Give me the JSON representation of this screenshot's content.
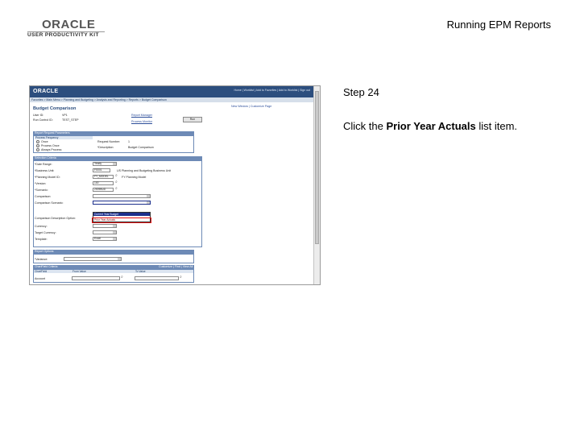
{
  "branding": {
    "logo_text": "ORACLE",
    "product_text": "USER PRODUCTIVITY KIT"
  },
  "document": {
    "title": "Running EPM Reports"
  },
  "step": {
    "title": "Step 24",
    "instruction_prefix": "Click the ",
    "instruction_target": "Prior Year Actuals",
    "instruction_suffix": " list item."
  },
  "screenshot": {
    "header": {
      "logo": "ORACLE",
      "links": "Home | Worklist | Add to Favorites | Add to Worklist | Sign out"
    },
    "nav": "Favorites > Main Menu > Planning and Budgeting > Analysis and Reporting > Reports > Budget Comparison",
    "page_title": "Budget Comparison",
    "run_control_label": "User ID:",
    "run_control_value": "VP1",
    "run_control_id_label": "Run Control ID:",
    "run_control_id_value": "TEST_STEP",
    "report_manager_link": "Report Manager",
    "process_monitor_link": "Process Monitor",
    "run_button": "Run",
    "toolbar_links": "New Window | Customize Page",
    "sections": {
      "report_request": "Report Request Parameters",
      "process_frequency": "Process Frequency",
      "selection_criteria": "Selection Criteria",
      "report_option": "Report Options",
      "chartfield_criteria": "ChartField Criteria"
    },
    "frequency_options": [
      "Once",
      "Process Once",
      "Always Process"
    ],
    "request_number_label": "Request Number:",
    "request_number_value": "1",
    "description_label": "*Description:",
    "description_value": "Budget Comparison",
    "fields": [
      {
        "label": "*Date Range:",
        "value": "Yearly"
      },
      {
        "label": "*Business Unit:",
        "value": "FS001"
      },
      {
        "label": "*Planning Model ID:",
        "value": "FY_MODEL"
      },
      {
        "label": "*Version:",
        "value": "100"
      },
      {
        "label": "*Scenario:",
        "value": "2009BUD"
      },
      {
        "label": "Comparison:",
        "value": ""
      },
      {
        "label": "Comparison Scenario:",
        "value": ""
      },
      {
        "label": "Comparison Description Option:",
        "value": ""
      },
      {
        "label": "Currency:",
        "value": ""
      },
      {
        "label": "Target Currency:",
        "value": ""
      },
      {
        "label": "Template:",
        "value": "Excel"
      }
    ],
    "business_unit_desc": "US Planning and Budgeting Business Unit",
    "planning_model_desc": "FY Planning Model",
    "dropdown_options": [
      "Current Year Budget",
      "Prior Year Actuals"
    ],
    "report_option_field_label": "*Variance:",
    "chartfield_header": "Customize | Find | View All",
    "chartfield_columns": [
      "ChartField",
      "From Value",
      "To Value"
    ],
    "chartfield_row": "Account"
  }
}
